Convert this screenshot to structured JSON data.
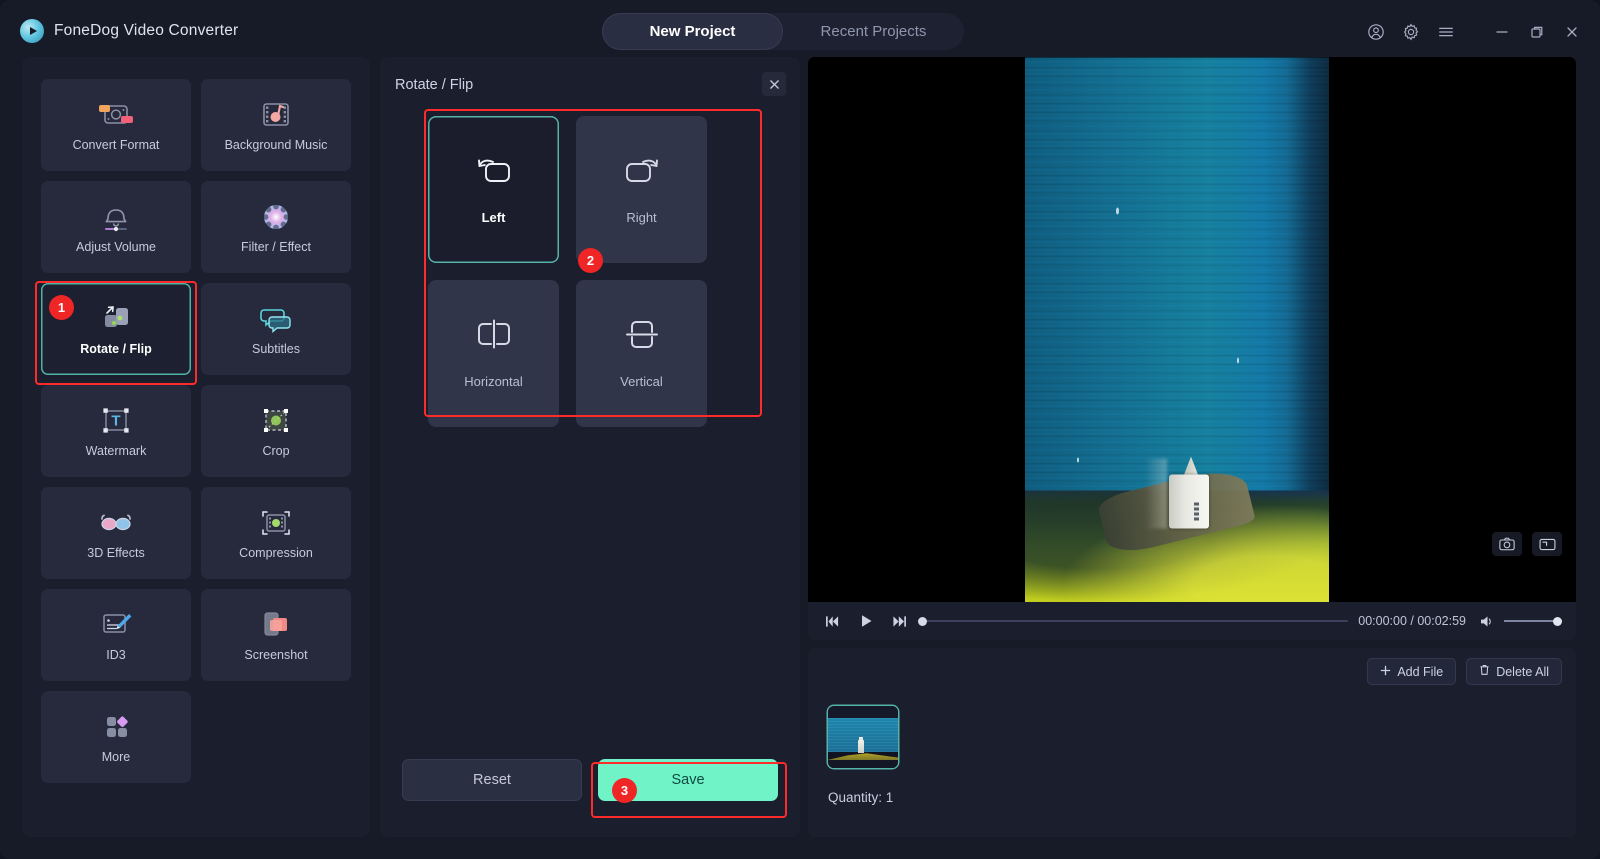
{
  "app": {
    "title": "FoneDog Video Converter",
    "logo_icon": "play-circle-icon"
  },
  "tabs": [
    {
      "label": "New Project",
      "active": true
    },
    {
      "label": "Recent Projects",
      "active": false
    }
  ],
  "window_controls": [
    {
      "name": "account-icon",
      "label": "Account"
    },
    {
      "name": "gear-icon",
      "label": "Settings"
    },
    {
      "name": "menu-icon",
      "label": "Menu"
    },
    {
      "name": "minimize-icon",
      "label": "Minimize"
    },
    {
      "name": "maximize-icon",
      "label": "Maximize"
    },
    {
      "name": "close-icon",
      "label": "Close"
    }
  ],
  "sidebar": {
    "tools": [
      {
        "label": "Convert Format",
        "icon": "convert-format-icon",
        "active": false
      },
      {
        "label": "Background Music",
        "icon": "music-film-icon",
        "active": false
      },
      {
        "label": "Adjust Volume",
        "icon": "volume-bell-icon",
        "active": false
      },
      {
        "label": "Filter / Effect",
        "icon": "filter-effect-icon",
        "active": false
      },
      {
        "label": "Rotate / Flip",
        "icon": "rotate-flip-icon",
        "active": true
      },
      {
        "label": "Subtitles",
        "icon": "subtitles-icon",
        "active": false
      },
      {
        "label": "Watermark",
        "icon": "watermark-text-icon",
        "active": false
      },
      {
        "label": "Crop",
        "icon": "crop-icon",
        "active": false
      },
      {
        "label": "3D Effects",
        "icon": "3d-glasses-icon",
        "active": false
      },
      {
        "label": "Compression",
        "icon": "compression-icon",
        "active": false
      },
      {
        "label": "ID3",
        "icon": "id3-edit-icon",
        "active": false
      },
      {
        "label": "Screenshot",
        "icon": "screenshot-icon",
        "active": false
      },
      {
        "label": "More",
        "icon": "more-grid-icon",
        "active": false
      }
    ]
  },
  "panel": {
    "title": "Rotate / Flip",
    "close_icon": "close-icon",
    "options": [
      {
        "label": "Left",
        "icon": "rotate-left-icon",
        "active": true
      },
      {
        "label": "Right",
        "icon": "rotate-right-icon",
        "active": false
      },
      {
        "label": "Horizontal",
        "icon": "flip-horizontal-icon",
        "active": false
      },
      {
        "label": "Vertical",
        "icon": "flip-vertical-icon",
        "active": false
      }
    ],
    "reset_label": "Reset",
    "save_label": "Save"
  },
  "steps": [
    {
      "number": "1",
      "target": "rotate-flip-sidebar-tool"
    },
    {
      "number": "2",
      "target": "rotate-options-group"
    },
    {
      "number": "3",
      "target": "save-button"
    }
  ],
  "preview": {
    "snapshot_icon": "camera-icon",
    "fullscreen_icon": "fullscreen-icon",
    "controls": {
      "prev_icon": "skip-previous-icon",
      "play_icon": "play-icon",
      "next_icon": "skip-next-icon",
      "volume_icon": "volume-icon"
    },
    "current_time": "00:00:00",
    "total_time": "00:02:59",
    "time_display": "00:00:00 / 00:02:59",
    "seek_position_percent": 0,
    "volume_percent": 100
  },
  "filelist": {
    "add_file_label": "Add File",
    "add_file_icon": "plus-icon",
    "delete_all_label": "Delete All",
    "delete_all_icon": "trash-icon",
    "quantity_label": "Quantity: 1",
    "thumbnail_name": "video-thumbnail"
  },
  "colors": {
    "app_background": "#171a27",
    "panel_background": "#1b1e2d",
    "tile_background": "#262a3c",
    "option_tile_background": "#313549",
    "accent_teal": "#55b3a8",
    "save_button": "#6ff3c7",
    "highlight_red": "#ff2a2a",
    "badge_red": "#f02525",
    "text_primary": "#ffffff",
    "text_secondary": "#c6cbdb"
  }
}
